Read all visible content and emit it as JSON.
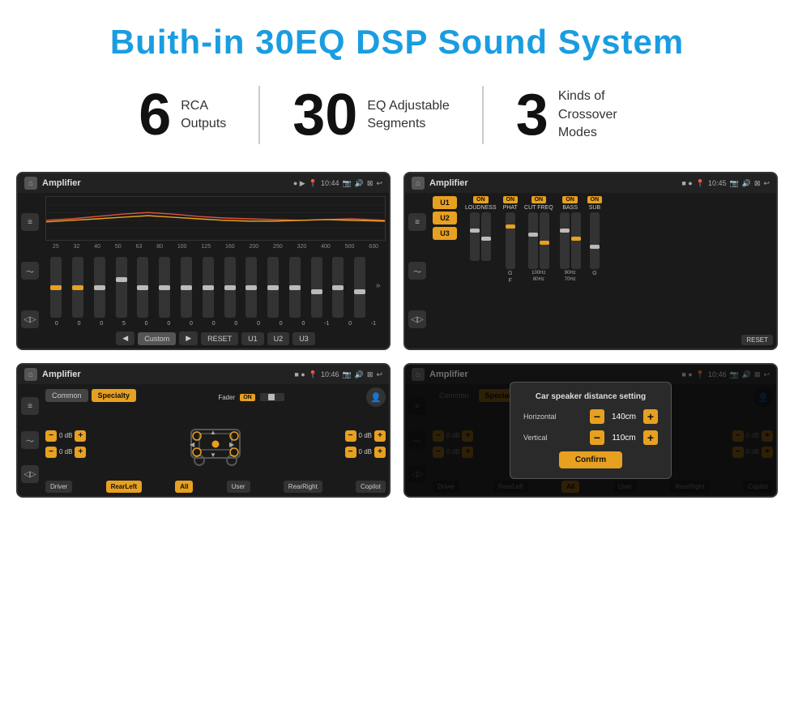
{
  "page": {
    "title": "Buith-in 30EQ DSP Sound System"
  },
  "stats": [
    {
      "number": "6",
      "label": "RCA\nOutputs"
    },
    {
      "number": "30",
      "label": "EQ Adjustable\nSegments"
    },
    {
      "number": "3",
      "label": "Kinds of\nCrossover Modes"
    }
  ],
  "screens": [
    {
      "id": "screen1",
      "title": "Amplifier",
      "time": "10:44",
      "description": "30-band EQ sliders"
    },
    {
      "id": "screen2",
      "title": "Amplifier",
      "time": "10:45",
      "description": "Amplifier EQ controls"
    },
    {
      "id": "screen3",
      "title": "Amplifier",
      "time": "10:46",
      "description": "Fader and speaker settings"
    },
    {
      "id": "screen4",
      "title": "Amplifier",
      "time": "10:46",
      "description": "Car speaker distance setting dialog"
    }
  ],
  "eq": {
    "freqs": [
      "25",
      "32",
      "40",
      "50",
      "63",
      "80",
      "100",
      "125",
      "160",
      "200",
      "250",
      "320",
      "400",
      "500",
      "630"
    ],
    "values": [
      "0",
      "0",
      "0",
      "5",
      "0",
      "0",
      "0",
      "0",
      "0",
      "0",
      "0",
      "0",
      "-1",
      "0",
      "-1"
    ],
    "presets": [
      "Custom",
      "RESET",
      "U1",
      "U2",
      "U3"
    ]
  },
  "amp": {
    "presets": [
      "U1",
      "U2",
      "U3"
    ],
    "controls": [
      "LOUDNESS",
      "PHAT",
      "CUT FREQ",
      "BASS",
      "SUB"
    ],
    "reset": "RESET"
  },
  "fader": {
    "tabs": [
      "Common",
      "Specialty"
    ],
    "label": "Fader",
    "on_label": "ON",
    "buttons": [
      "Driver",
      "RearLeft",
      "All",
      "User",
      "RearRight",
      "Copilot"
    ]
  },
  "dialog": {
    "title": "Car speaker distance setting",
    "horizontal_label": "Horizontal",
    "horizontal_value": "140cm",
    "vertical_label": "Vertical",
    "vertical_value": "110cm",
    "confirm_label": "Confirm"
  }
}
